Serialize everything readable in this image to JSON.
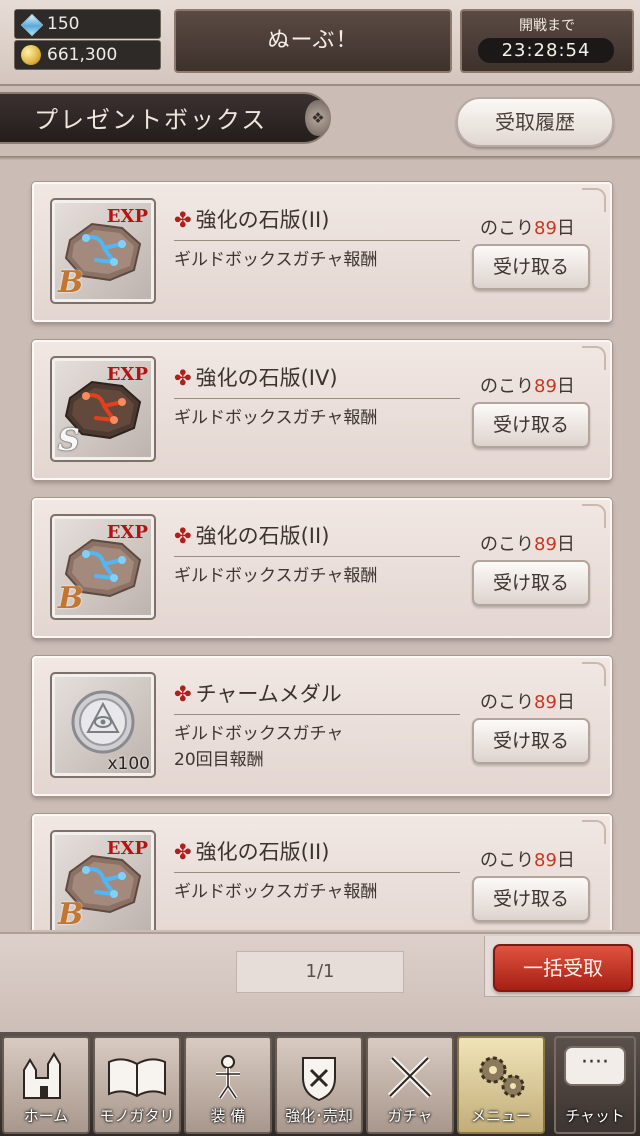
{
  "status": {
    "gems": "150",
    "gold": "661,300",
    "player_name": "ぬーぶ！",
    "timer_label": "開戦まで",
    "timer_value": "23:28:54"
  },
  "header": {
    "title": "プレゼントボックス",
    "history_button": "受取履歴"
  },
  "items": [
    {
      "name": "強化の石版(II)",
      "desc": "ギルドボックスガチャ報酬",
      "remain_prefix": "のこり",
      "remain_days": "89",
      "remain_suffix": "日",
      "button": "受け取る",
      "icon": "exp-tablet-blue-icon",
      "exp": "EXP",
      "rank": "B",
      "qty": ""
    },
    {
      "name": "強化の石版(IV)",
      "desc": "ギルドボックスガチャ報酬",
      "remain_prefix": "のこり",
      "remain_days": "89",
      "remain_suffix": "日",
      "button": "受け取る",
      "icon": "exp-tablet-red-icon",
      "exp": "EXP",
      "rank": "S",
      "qty": ""
    },
    {
      "name": "強化の石版(II)",
      "desc": "ギルドボックスガチャ報酬",
      "remain_prefix": "のこり",
      "remain_days": "89",
      "remain_suffix": "日",
      "button": "受け取る",
      "icon": "exp-tablet-blue-icon",
      "exp": "EXP",
      "rank": "B",
      "qty": ""
    },
    {
      "name": "チャームメダル",
      "desc": "ギルドボックスガチャ\n20回目報酬",
      "remain_prefix": "のこり",
      "remain_days": "89",
      "remain_suffix": "日",
      "button": "受け取る",
      "icon": "charm-medal-icon",
      "exp": "",
      "rank": "",
      "qty": "x100"
    },
    {
      "name": "強化の石版(II)",
      "desc": "ギルドボックスガチャ報酬",
      "remain_prefix": "のこり",
      "remain_days": "89",
      "remain_suffix": "日",
      "button": "受け取る",
      "icon": "exp-tablet-blue-icon",
      "exp": "EXP",
      "rank": "B",
      "qty": ""
    }
  ],
  "item_mark": "✤",
  "pager": "1/1",
  "bulk_button": "一括受取",
  "nav": [
    {
      "label": "ホーム",
      "icon": "castle-icon"
    },
    {
      "label": "モノガタリ",
      "icon": "book-icon"
    },
    {
      "label": "装 備",
      "icon": "equipment-icon"
    },
    {
      "label": "強化･売却",
      "icon": "enhance-icon"
    },
    {
      "label": "ガチャ",
      "icon": "crossed-swords-icon"
    },
    {
      "label": "メニュー",
      "icon": "gears-icon"
    }
  ],
  "chat": {
    "label": "チャット",
    "bubble": "····"
  }
}
